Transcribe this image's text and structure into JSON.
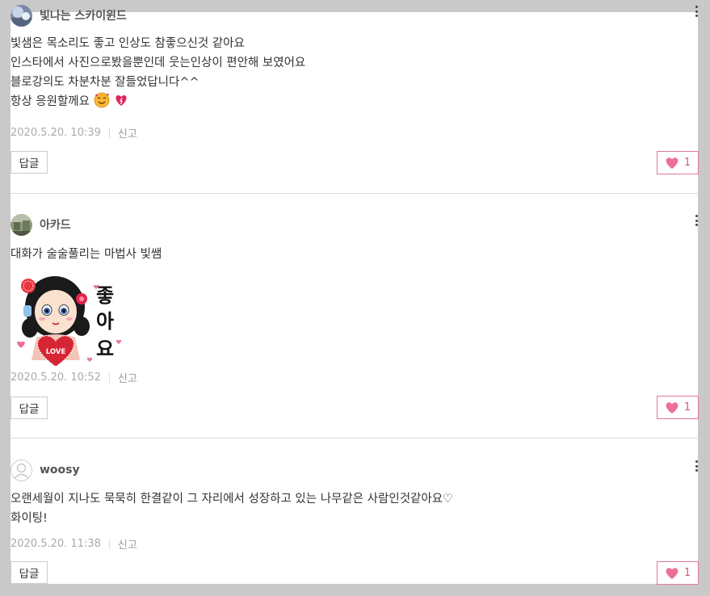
{
  "comments": [
    {
      "author": "빛나는 스카이윈드",
      "lines": [
        "빛샘은 목소리도 좋고 인상도 참좋으신것 같아요",
        "인스타에서 사진으로봤을뿐인데 웃는인상이 편안해 보였어요",
        "블로강의도 차분차분 잘들었답니다^^",
        "항상 응원할께요"
      ],
      "date": "2020.5.20. 10:39",
      "report": "신고",
      "reply": "답글",
      "likes": "1"
    },
    {
      "author": "아카드",
      "lines": [
        "대화가 술술풀리는 마법사 빛쌤"
      ],
      "sticker": {
        "heart_text": "LOVE",
        "side_text": [
          "좋",
          "아",
          "요"
        ]
      },
      "date": "2020.5.20. 10:52",
      "report": "신고",
      "reply": "답글",
      "likes": "1"
    },
    {
      "author": "woosy",
      "lines": [
        "오랜세월이 지나도 묵묵히 한결같이 그 자리에서 성장하고 있는 나무같은 사람인것같아요♡",
        "화이팅!"
      ],
      "date": "2020.5.20. 11:38",
      "report": "신고",
      "reply": "답글",
      "likes": "1"
    }
  ],
  "colors": {
    "like_accent": "#e2799a",
    "heart": "#ec6f94"
  }
}
